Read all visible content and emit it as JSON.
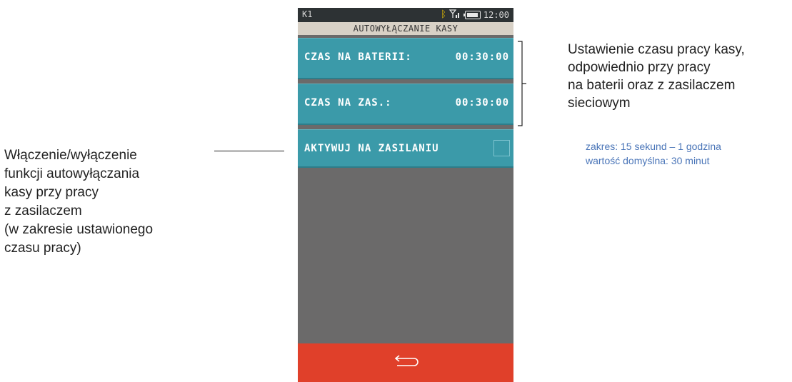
{
  "device": {
    "status": {
      "left": "K1",
      "time": "12:00",
      "icons": [
        "bluetooth-icon",
        "signal-icon",
        "battery-icon"
      ]
    },
    "title": "AUTOWYŁĄCZANIE KASY",
    "rows": [
      {
        "label": "CZAS NA BATERII:",
        "value": "00:30:00"
      },
      {
        "label": "CZAS NA ZAS.:",
        "value": "00:30:00"
      },
      {
        "label": "AKTYWUJ NA ZASILANIU",
        "checked": false
      }
    ],
    "footer": {
      "icon": "back-arrow-icon"
    }
  },
  "annotations": {
    "right_lines": [
      "Ustawienie czasu pracy kasy,",
      "odpowiednio przy pracy",
      "na baterii oraz z zasilaczem",
      "sieciowym"
    ],
    "note_lines": [
      "zakres: 15 sekund – 1 godzina",
      "wartość domyślna: 30 minut"
    ],
    "left_lines": [
      "Włączenie/wyłączenie",
      "funkcji autowyłączania",
      "kasy przy pracy",
      "z zasilaczem",
      "(w zakresie ustawionego",
      "czasu pracy)"
    ]
  },
  "colors": {
    "row_bg": "#3b9aa9",
    "footer_bg": "#e0402a",
    "screen_bg": "#6b6a6a",
    "note_text": "#4a75b8"
  }
}
